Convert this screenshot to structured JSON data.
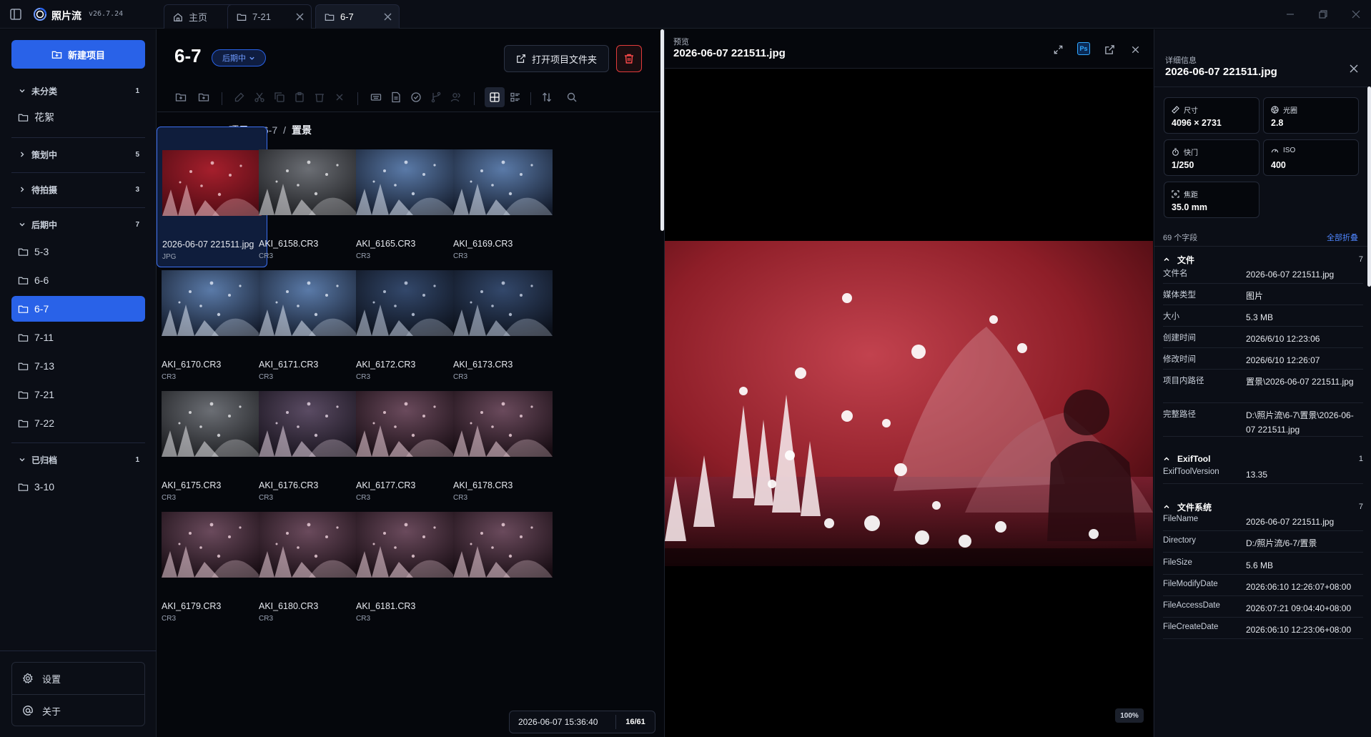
{
  "app": {
    "name": "照片流",
    "version": "v26.7.24"
  },
  "tabs": [
    {
      "label": "主页",
      "icon": "home-icon",
      "closable": false,
      "active": false
    },
    {
      "label": "7-21",
      "icon": "folder-icon",
      "closable": true,
      "active": false
    },
    {
      "label": "6-7",
      "icon": "folder-icon",
      "closable": true,
      "active": true
    }
  ],
  "sidebar": {
    "new_project_label": "新建项目",
    "groups": [
      {
        "label": "未分类",
        "count": "1",
        "items": [
          "花絮"
        ]
      },
      {
        "label": "策划中",
        "count": "5",
        "items": []
      },
      {
        "label": "待拍摄",
        "count": "3",
        "items": []
      },
      {
        "label": "后期中",
        "count": "7",
        "items": [
          "5-3",
          "6-6",
          "6-7",
          "7-11",
          "7-13",
          "7-21",
          "7-22"
        ]
      },
      {
        "label": "已归档",
        "count": "1",
        "items": [
          "3-10"
        ]
      }
    ],
    "active_item": "6-7",
    "settings_label": "设置",
    "about_label": "关于"
  },
  "project": {
    "title": "6-7",
    "status": "后期中",
    "open_folder_label": "打开项目文件夹"
  },
  "breadcrumb": {
    "root": "项目",
    "project": "6-7",
    "current": "置景"
  },
  "thumbnails": [
    {
      "name": "2026-06-07 221511.jpg",
      "ext": "JPG",
      "tone": "red"
    },
    {
      "name": "AKI_6158.CR3",
      "ext": "CR3",
      "tone": "gray"
    },
    {
      "name": "AKI_6165.CR3",
      "ext": "CR3",
      "tone": "blue"
    },
    {
      "name": "AKI_6169.CR3",
      "ext": "CR3",
      "tone": "blue"
    },
    {
      "name": "AKI_6170.CR3",
      "ext": "CR3",
      "tone": "blue"
    },
    {
      "name": "AKI_6171.CR3",
      "ext": "CR3",
      "tone": "blue"
    },
    {
      "name": "AKI_6172.CR3",
      "ext": "CR3",
      "tone": "darkblue"
    },
    {
      "name": "AKI_6173.CR3",
      "ext": "CR3",
      "tone": "darkblue"
    },
    {
      "name": "AKI_6175.CR3",
      "ext": "CR3",
      "tone": "gray"
    },
    {
      "name": "AKI_6176.CR3",
      "ext": "CR3",
      "tone": "mixed"
    },
    {
      "name": "AKI_6177.CR3",
      "ext": "CR3",
      "tone": "pink"
    },
    {
      "name": "AKI_6178.CR3",
      "ext": "CR3",
      "tone": "pink"
    },
    {
      "name": "AKI_6179.CR3",
      "ext": "CR3",
      "tone": "pink"
    },
    {
      "name": "AKI_6180.CR3",
      "ext": "CR3",
      "tone": "pink"
    },
    {
      "name": "AKI_6181.CR3",
      "ext": "CR3",
      "tone": "pink"
    },
    {
      "name": "",
      "ext": "",
      "tone": "pink"
    }
  ],
  "status": {
    "datetime": "2026-06-07 15:36:40",
    "page": "16/61"
  },
  "preview": {
    "label": "预览",
    "filename": "2026-06-07 221511.jpg",
    "ps_label": "Ps",
    "zoom": "100%"
  },
  "details": {
    "label": "详细信息",
    "filename": "2026-06-07 221511.jpg",
    "cards": [
      {
        "label": "尺寸",
        "value": "4096 × 2731",
        "icon": "ruler-icon"
      },
      {
        "label": "光圈",
        "value": "2.8",
        "icon": "aperture-icon"
      },
      {
        "label": "快门",
        "value": "1/250",
        "icon": "timer-icon"
      },
      {
        "label": "ISO",
        "value": "400",
        "icon": "gauge-icon"
      },
      {
        "label": "焦距",
        "value": "35.0 mm",
        "icon": "focus-icon"
      }
    ],
    "field_count": "69 个字段",
    "collapse_all": "全部折叠",
    "sections": [
      {
        "title": "文件",
        "count": "7",
        "rows": [
          {
            "k": "文件名",
            "v": "2026-06-07 221511.jpg"
          },
          {
            "k": "媒体类型",
            "v": "图片"
          },
          {
            "k": "大小",
            "v": "5.3 MB"
          },
          {
            "k": "创建时间",
            "v": "2026/6/10 12:23:06"
          },
          {
            "k": "修改时间",
            "v": "2026/6/10 12:26:07"
          },
          {
            "k": "项目内路径",
            "v": "置景\\2026-06-07 221511.jpg"
          },
          {
            "k": "完整路径",
            "v": "D:\\照片流\\6-7\\置景\\2026-06-07 221511.jpg"
          }
        ]
      },
      {
        "title": "ExifTool",
        "count": "1",
        "rows": [
          {
            "k": "ExifToolVersion",
            "v": "13.35"
          }
        ]
      },
      {
        "title": "文件系统",
        "count": "7",
        "rows": [
          {
            "k": "FileName",
            "v": "2026-06-07 221511.jpg"
          },
          {
            "k": "Directory",
            "v": "D:/照片流/6-7/置景"
          },
          {
            "k": "FileSize",
            "v": "5.6 MB"
          },
          {
            "k": "FileModifyDate",
            "v": "2026:06:10 12:26:07+08:00"
          },
          {
            "k": "FileAccessDate",
            "v": "2026:07:21 09:04:40+08:00"
          },
          {
            "k": "FileCreateDate",
            "v": "2026:06:10 12:23:06+08:00"
          }
        ]
      }
    ]
  },
  "colors": {
    "accent": "#2962e8",
    "danger": "#ff4a4a",
    "link": "#4f86ff",
    "bg": "#05070c",
    "panel": "#0b0e16"
  }
}
